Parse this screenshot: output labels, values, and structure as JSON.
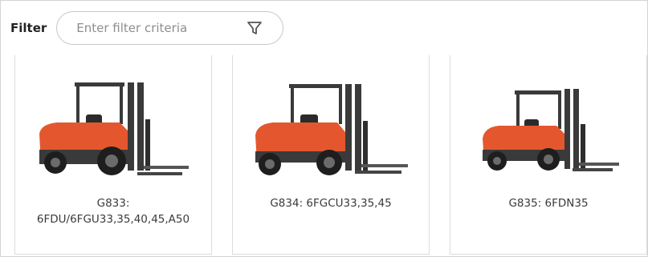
{
  "filter": {
    "label": "Filter",
    "placeholder": "Enter filter criteria",
    "value": "",
    "icon": "funnel-icon"
  },
  "products": [
    {
      "title_line1": "G833:",
      "title_line2": "6FDU/6FGU33,35,40,45,A50",
      "image": "forklift-image"
    },
    {
      "title_line1": "G834: 6FGCU33,35,45",
      "title_line2": "",
      "image": "forklift-image"
    },
    {
      "title_line1": "G835: 6FDN35",
      "title_line2": "",
      "image": "forklift-image"
    }
  ],
  "colors": {
    "forklift_body": "#e4572e",
    "forklift_dark": "#3a3a3a",
    "border": "#dcdcdc"
  }
}
